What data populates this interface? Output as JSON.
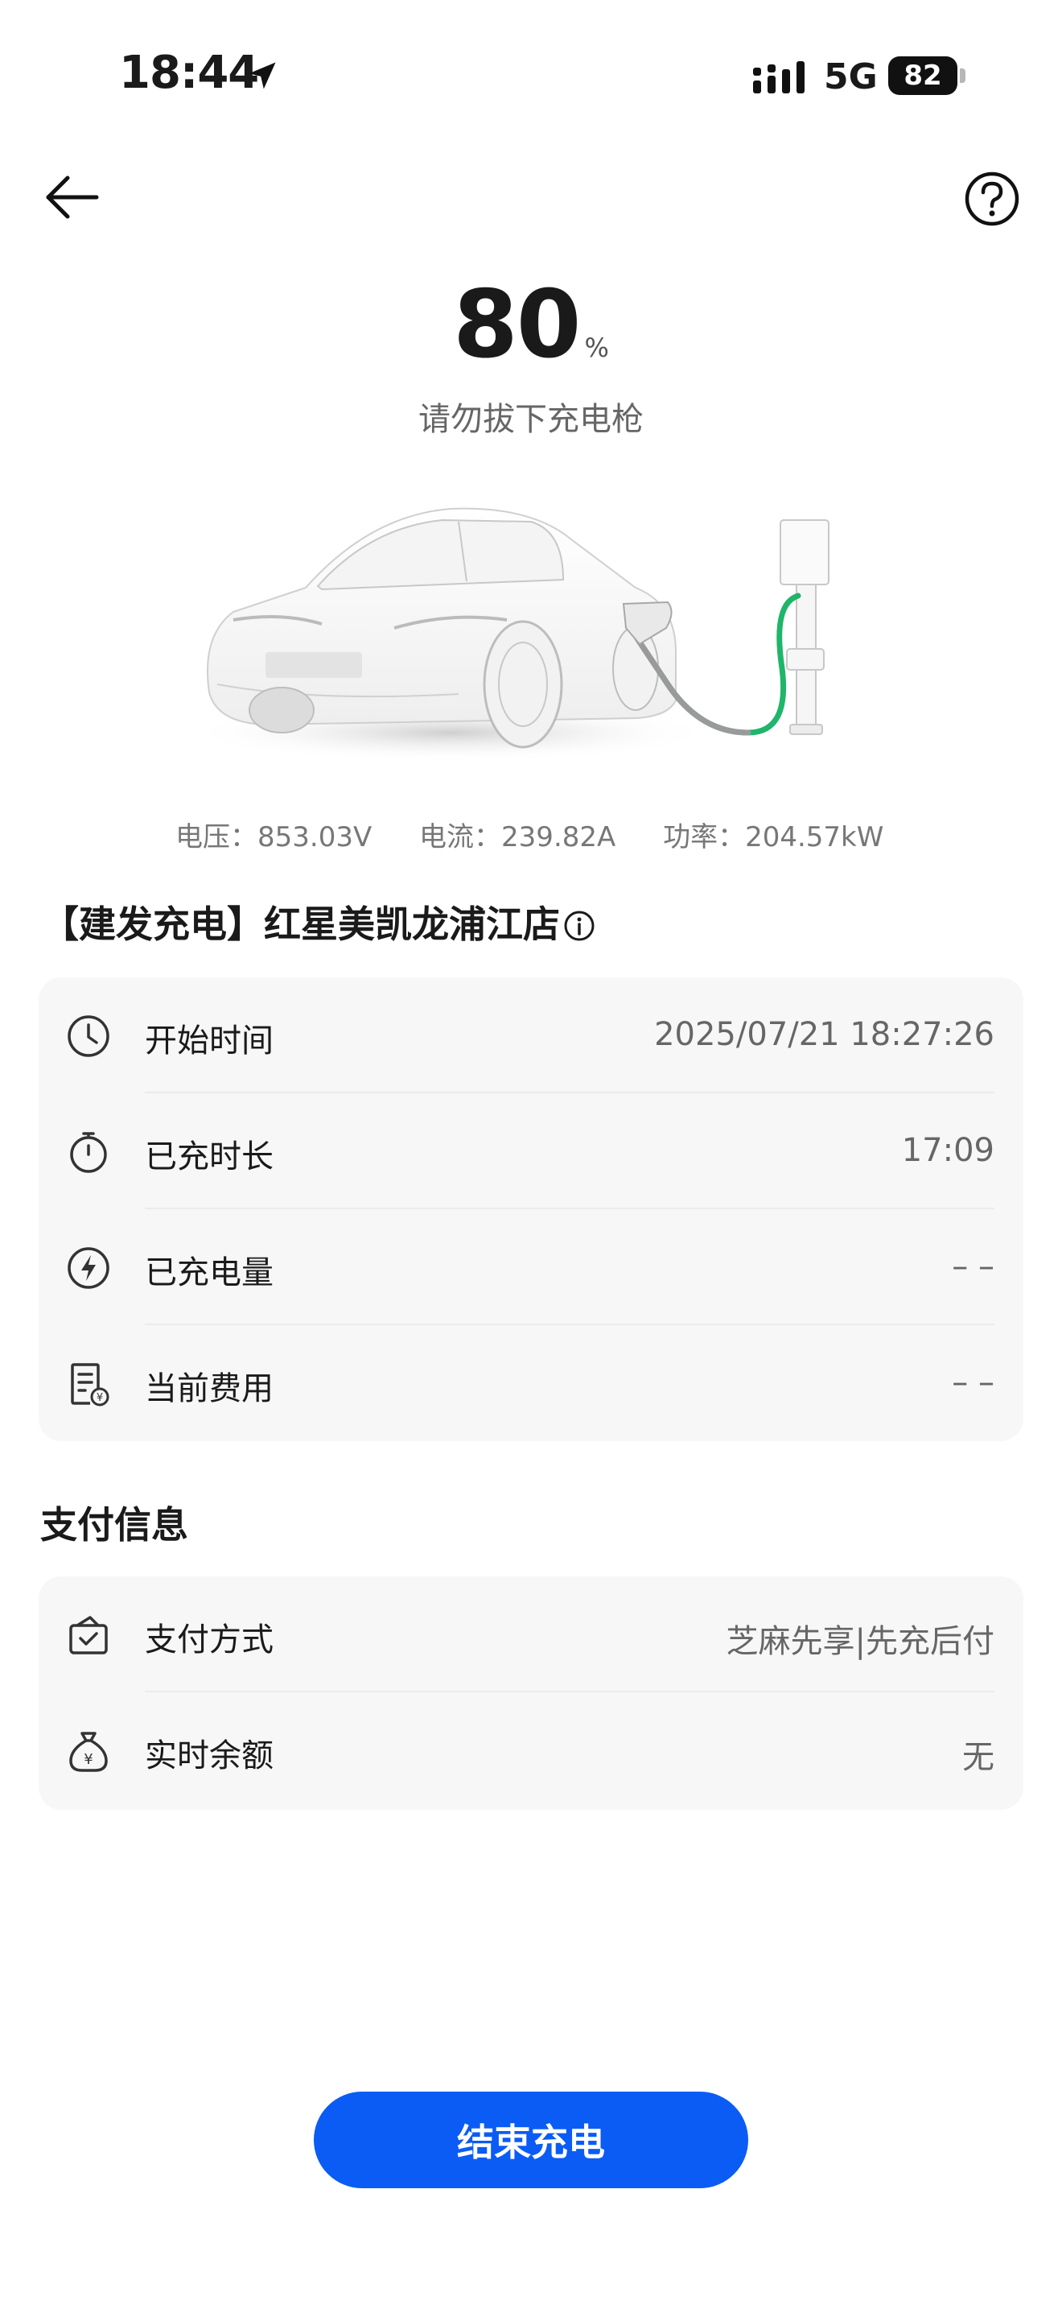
{
  "status_bar": {
    "time": "18:44",
    "network": "5G",
    "battery": "82"
  },
  "header": {
    "back_icon": "arrow-left-icon",
    "help_icon": "question-circle-icon"
  },
  "charging": {
    "percent": "80",
    "percent_unit": "%",
    "hint": "请勿拔下充电枪",
    "metrics": {
      "voltage": "电压：853.03V",
      "current": "电流：239.82A",
      "power": "功率：204.57kW"
    }
  },
  "station": {
    "name": "【建发充电】红星美凯龙浦江店",
    "info_icon": "info-circle-icon"
  },
  "session_card": {
    "rows": [
      {
        "icon": "clock-icon",
        "label": "开始时间",
        "value": "2025/07/21 18:27:26"
      },
      {
        "icon": "stopwatch-icon",
        "label": "已充时长",
        "value": "17:09"
      },
      {
        "icon": "bolt-circle-icon",
        "label": "已充电量",
        "value": "– –"
      },
      {
        "icon": "receipt-yuan-icon",
        "label": "当前费用",
        "value": "– –"
      }
    ]
  },
  "payment": {
    "title": "支付信息",
    "rows": [
      {
        "icon": "wallet-check-icon",
        "label": "支付方式",
        "value": "芝麻先享|先充后付"
      },
      {
        "icon": "money-bag-icon",
        "label": "实时余额",
        "value": "无"
      }
    ]
  },
  "end_button": {
    "label": "结束充电"
  },
  "colors": {
    "accent": "#0a5cf5",
    "cable_green": "#1fb56a",
    "card_bg": "#f7f7f7"
  }
}
